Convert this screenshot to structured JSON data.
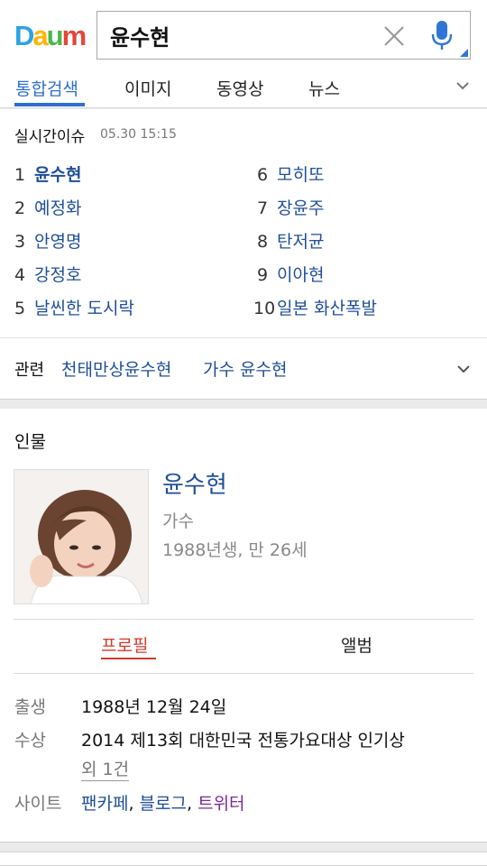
{
  "header": {
    "logo": {
      "letters": [
        "D",
        "a",
        "u",
        "m"
      ],
      "colors": [
        "#2aa3e6",
        "#ffb400",
        "#49b947",
        "#e6453a"
      ]
    },
    "search": {
      "value": "윤수현",
      "placeholder": ""
    },
    "icons": {
      "clear": "close-icon",
      "mic": "mic-icon"
    },
    "tabs": [
      {
        "label": "통합검색",
        "active": true
      },
      {
        "label": "이미지",
        "active": false
      },
      {
        "label": "동영상",
        "active": false
      },
      {
        "label": "뉴스",
        "active": false
      }
    ]
  },
  "trending": {
    "title": "실시간이슈",
    "time": "05.30 15:15",
    "items": [
      {
        "rank": "1",
        "label": "윤수현"
      },
      {
        "rank": "2",
        "label": "예정화"
      },
      {
        "rank": "3",
        "label": "안영명"
      },
      {
        "rank": "4",
        "label": "강정호"
      },
      {
        "rank": "5",
        "label": "날씬한 도시락"
      },
      {
        "rank": "6",
        "label": "모히또"
      },
      {
        "rank": "7",
        "label": "장윤주"
      },
      {
        "rank": "8",
        "label": "탄저균"
      },
      {
        "rank": "9",
        "label": "이아현"
      },
      {
        "rank": "10",
        "label": "일본 화산폭발"
      }
    ]
  },
  "related": {
    "label": "관련",
    "links": [
      "천태만상윤수현",
      "가수 윤수현"
    ]
  },
  "person": {
    "section_title": "인물",
    "name": "윤수현",
    "job": "가수",
    "birth_summary": "1988년생, 만 26세",
    "subtabs": [
      "프로필",
      "앨범"
    ],
    "info": {
      "birth_label": "출생",
      "birth_value": "1988년 12월 24일",
      "award_label": "수상",
      "award_value": "2014 제13회 대한민국 전통가요대상 인기상",
      "award_more": "외 1건",
      "site_label": "사이트",
      "sites": [
        "팬카페",
        "블로그",
        "트위터"
      ],
      "site_separator": ", "
    }
  },
  "colors": {
    "accent": "#2f6fd0",
    "link": "#1f4f99",
    "visited_link": "#7a2a96",
    "active_subtab": "#d0392b"
  }
}
